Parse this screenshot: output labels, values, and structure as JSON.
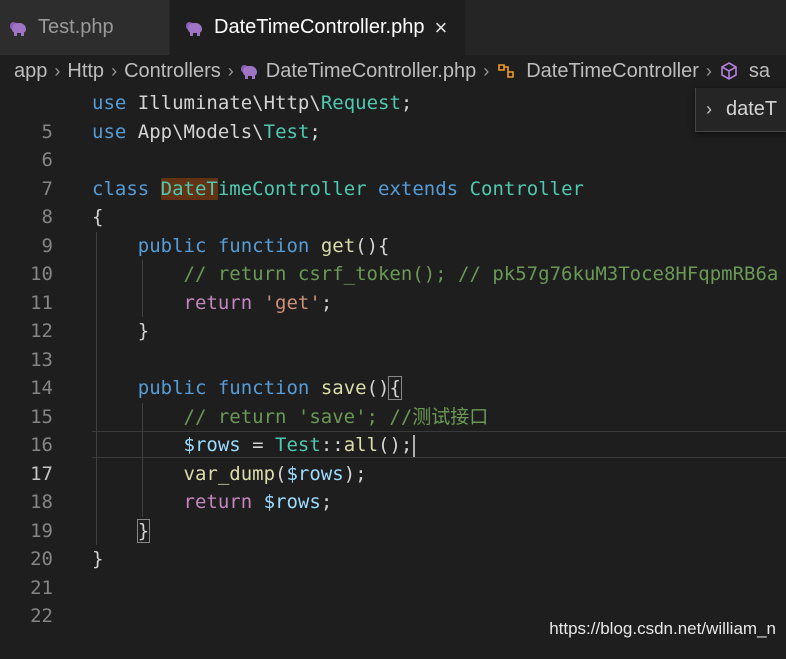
{
  "tabs": [
    {
      "label": "Test.php",
      "active": false
    },
    {
      "label": "DateTimeController.php",
      "active": true,
      "close": "×"
    }
  ],
  "breadcrumb": {
    "items": [
      "app",
      "Http",
      "Controllers",
      "DateTimeController.php",
      "DateTimeController",
      "sa"
    ],
    "separator": "›"
  },
  "sticky": {
    "chevron": "›",
    "label": "dateT"
  },
  "editor": {
    "current_line": 17,
    "line_numbers": [
      "5",
      "6",
      "7",
      "8",
      "9",
      "10",
      "11",
      "12",
      "13",
      "14",
      "15",
      "16",
      "17",
      "18",
      "19",
      "20",
      "21",
      "22"
    ],
    "lines": {
      "l5": {
        "use": "use",
        "ns": "Illuminate\\Http\\",
        "cls": "Request",
        "end": ";"
      },
      "l6": {
        "use": "use",
        "ns": "App\\Models\\",
        "cls": "Test",
        "end": ";"
      },
      "l8": {
        "class": "class",
        "name_hl": "DateT",
        "name_rest": "imeController",
        "extends": "extends",
        "parent": "Controller"
      },
      "l9": {
        "brace": "{"
      },
      "l10": {
        "public": "public",
        "function": "function",
        "name": "get",
        "rest": "(){"
      },
      "l11": {
        "comment": "// return csrf_token(); // pk57g76kuM3Toce8HFqpmRB6a"
      },
      "l12": {
        "return": "return",
        "str": "'get'",
        "end": ";"
      },
      "l13": {
        "brace": "}"
      },
      "l15": {
        "public": "public",
        "function": "function",
        "name": "save",
        "paren": "()",
        "brace": "{"
      },
      "l16": {
        "comment": "// return 'save'; //测试接口"
      },
      "l17": {
        "var": "$rows",
        "eq": " = ",
        "cls": "Test",
        "sep": "::",
        "fn": "all",
        "end": "();"
      },
      "l18": {
        "fn": "var_dump",
        "open": "(",
        "var": "$rows",
        "close": ");"
      },
      "l19": {
        "return": "return",
        "var": "$rows",
        "end": ";"
      },
      "l20": {
        "brace": "}"
      },
      "l21": {
        "brace": "}"
      }
    }
  },
  "watermark": "https://blog.csdn.net/william_n",
  "colors": {
    "background": "#1e1e1e",
    "keyword": "#569cd6",
    "control": "#c586c0",
    "class": "#4ec9b0",
    "function": "#dcdcaa",
    "variable": "#9cdcfe",
    "string": "#ce9178",
    "comment": "#6a9955",
    "highlight": "#613214"
  }
}
